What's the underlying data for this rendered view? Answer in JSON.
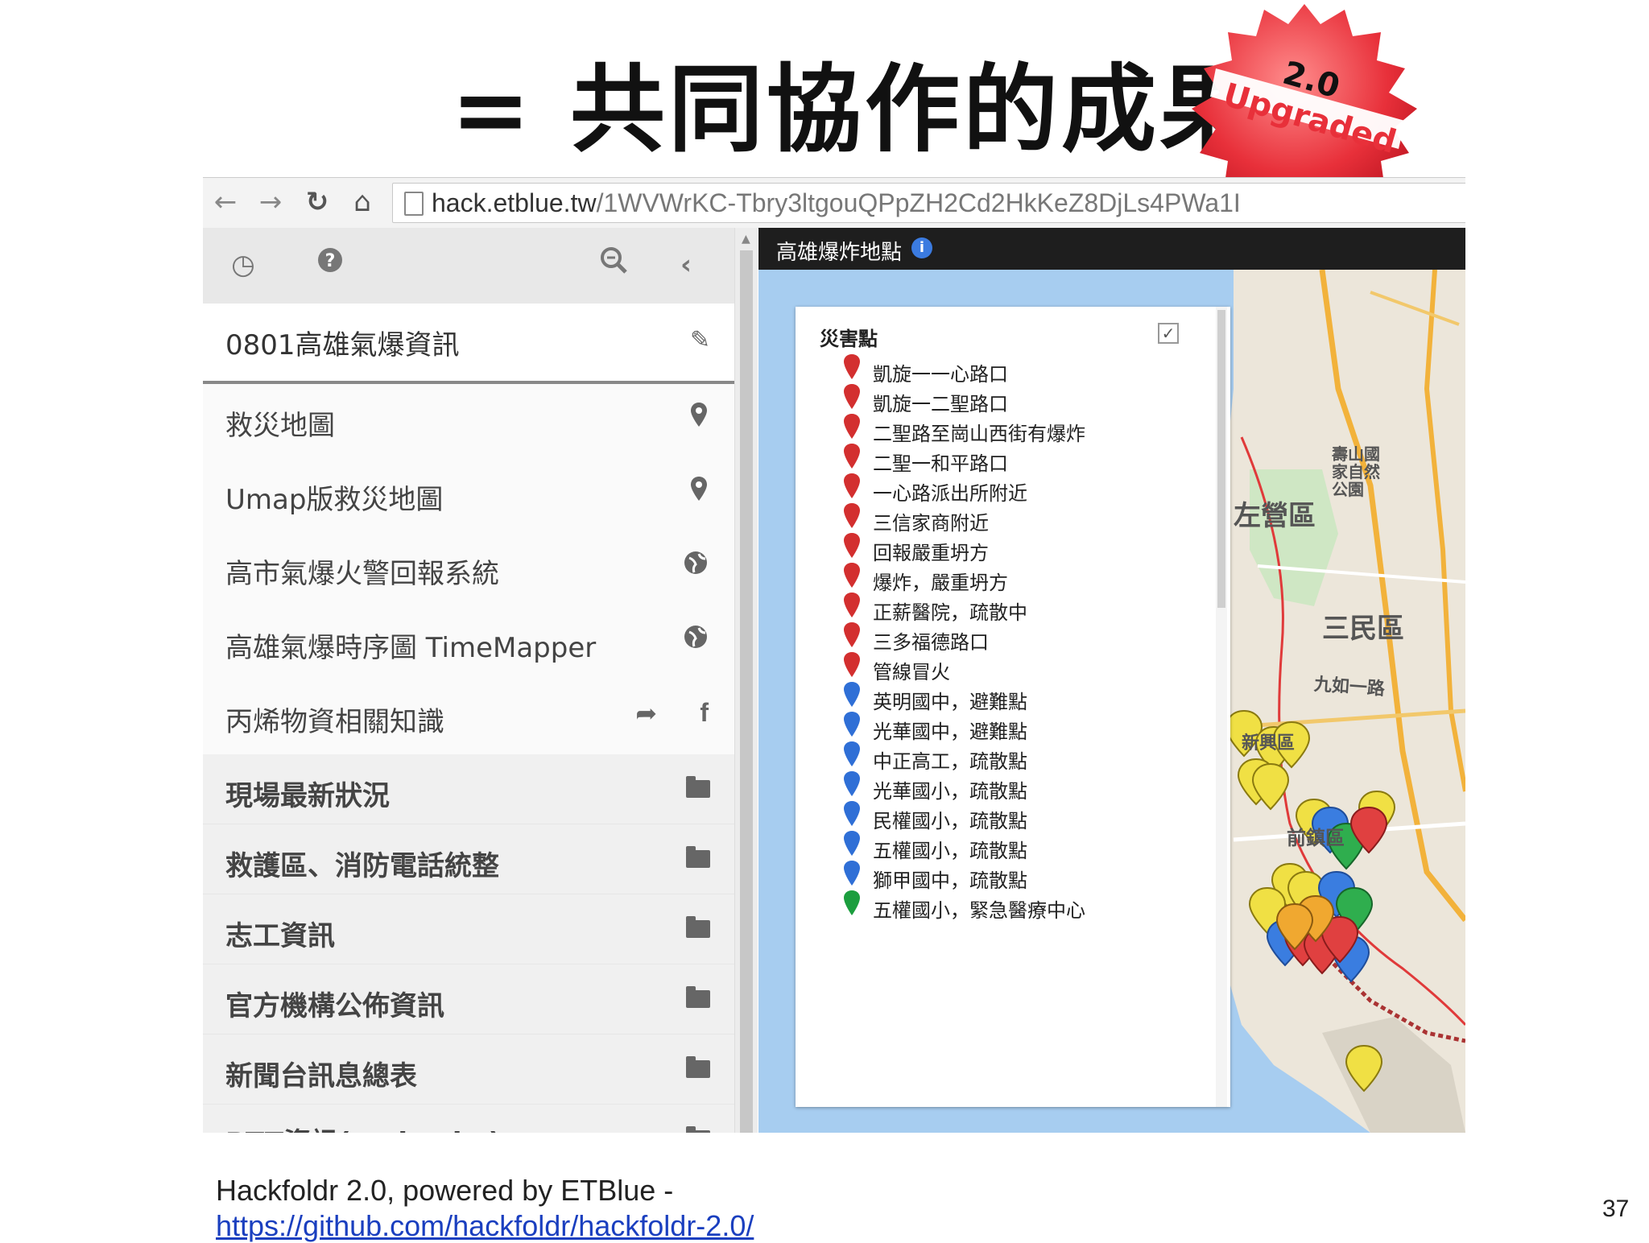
{
  "slide": {
    "title": "= 共同協作的成果",
    "badge_version": "2.0",
    "badge_text": "Upgraded",
    "caption": "Hackfoldr 2.0, powered by ETBlue -",
    "caption_link": "https://github.com/hackfoldr/hackfoldr-2.0/",
    "page_number": "37"
  },
  "browser": {
    "url_domain": "hack.etblue.tw",
    "url_path": "/1WVWrKC-Tbry3ltgouQPpZH2Cd2HkKeZ8DjLs4PWa1I"
  },
  "sidebar": {
    "title": "0801高雄氣爆資訊",
    "links": [
      {
        "label": "救災地圖",
        "icon": "map-marker-icon"
      },
      {
        "label": "Umap版救災地圖",
        "icon": "map-marker-icon"
      },
      {
        "label": "高市氣爆火警回報系統",
        "icon": "globe-icon"
      },
      {
        "label": "高雄氣爆時序圖 TimeMapper",
        "icon": "globe-icon"
      },
      {
        "label": "丙烯物資相關知識",
        "icon": "share-icon"
      }
    ],
    "folders": [
      {
        "label": "現場最新狀況"
      },
      {
        "label": "救護區、消防電話統整"
      },
      {
        "label": "志工資訊"
      },
      {
        "label": "官方機構公佈資訊"
      },
      {
        "label": "新聞台訊息總表"
      },
      {
        "label": "PTT資訊(mobcake)"
      }
    ]
  },
  "map": {
    "header_title": "高雄爆炸地點",
    "legend_title": "災害點",
    "legend_checked": true,
    "labels": [
      "左營區",
      "三民區",
      "新興區",
      "前鎮區",
      "九如一路",
      "壽山國家自然公園"
    ],
    "entries": [
      {
        "text": "凱旋一一心路口",
        "color": "#d32f2f"
      },
      {
        "text": "凱旋一二聖路口",
        "color": "#d32f2f"
      },
      {
        "text": "二聖路至崗山西街有爆炸",
        "color": "#d32f2f"
      },
      {
        "text": "二聖一和平路口",
        "color": "#d32f2f"
      },
      {
        "text": "一心路派出所附近",
        "color": "#d32f2f"
      },
      {
        "text": "三信家商附近",
        "color": "#d32f2f"
      },
      {
        "text": "回報嚴重坍方",
        "color": "#d32f2f"
      },
      {
        "text": "爆炸，嚴重坍方",
        "color": "#d32f2f"
      },
      {
        "text": "正薪醫院，疏散中",
        "color": "#d32f2f"
      },
      {
        "text": "三多福德路口",
        "color": "#d32f2f"
      },
      {
        "text": "管線冒火",
        "color": "#d32f2f"
      },
      {
        "text": "英明國中，避難點",
        "color": "#2f6fd6"
      },
      {
        "text": "光華國中，避難點",
        "color": "#2f6fd6"
      },
      {
        "text": "中正高工，疏散點",
        "color": "#2f6fd6"
      },
      {
        "text": "光華國小，疏散點",
        "color": "#2f6fd6"
      },
      {
        "text": "民權國小，疏散點",
        "color": "#2f6fd6"
      },
      {
        "text": "五權國小，疏散點",
        "color": "#2f6fd6"
      },
      {
        "text": "獅甲國中，疏散點",
        "color": "#2f6fd6"
      },
      {
        "text": "五權國小，緊急醫療中心",
        "color": "#1b9e3e"
      }
    ]
  }
}
